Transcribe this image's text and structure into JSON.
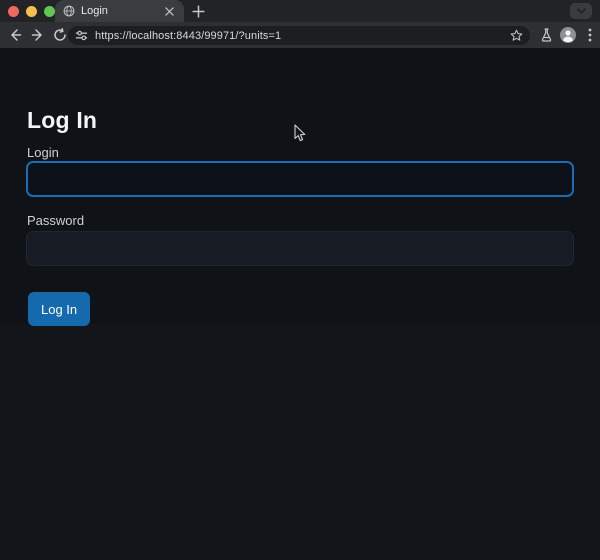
{
  "window": {
    "controls": [
      "close-button",
      "minimize-button",
      "zoom-button"
    ],
    "tab": {
      "title": "Login",
      "favicon": "globe-icon",
      "close": "close-icon"
    },
    "new_tab": "new-tab-icon",
    "tab_search": "chevron-down-icon"
  },
  "toolbar": {
    "back": "arrow-left-icon",
    "forward": "arrow-right-icon",
    "reload": "reload-icon",
    "site_settings": "tune-icon",
    "url": "https://localhost:8443/99971/?units=1",
    "bookmark": "star-icon",
    "experiments": "flask-icon",
    "profile": "avatar-icon",
    "menu": "kebab-menu-icon"
  },
  "page": {
    "heading": "Log In",
    "login_label": "Login",
    "login_value": "",
    "password_label": "Password",
    "password_value": "",
    "submit_label": "Log In"
  },
  "colors": {
    "accent_blue_border": "#1a6cb4",
    "button_blue": "#1569ad",
    "page_background": "#0f1216",
    "body_background": "#12161b",
    "toolbar_background": "#2e2f33",
    "tabstrip_background": "#222326"
  }
}
